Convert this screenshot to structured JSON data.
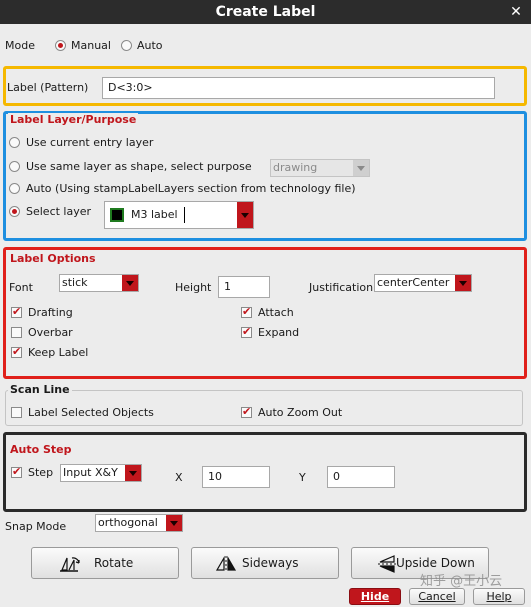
{
  "window": {
    "title": "Create Label",
    "close_glyph": "✕"
  },
  "mode": {
    "label": "Mode",
    "options": [
      {
        "label": "Manual",
        "selected": true
      },
      {
        "label": "Auto",
        "selected": false
      }
    ]
  },
  "label_pattern": {
    "label": "Label (Pattern)",
    "value": "D<3:0>"
  },
  "layer_purpose": {
    "title": "Label Layer/Purpose",
    "options": [
      {
        "label": "Use current entry layer",
        "selected": false
      },
      {
        "label": "Use same layer as shape, select purpose",
        "selected": false
      },
      {
        "label": "Auto (Using stampLabelLayers section from technology file)",
        "selected": false
      },
      {
        "label": "Select layer",
        "selected": true
      }
    ],
    "purpose_value": "drawing",
    "layer_value": "M3 label",
    "layer_swatch_color": "#1f7a1f"
  },
  "label_options": {
    "title": "Label Options",
    "font_label": "Font",
    "font_value": "stick",
    "height_label": "Height",
    "height_value": "1",
    "justification_label": "Justification",
    "justification_value": "centerCenter",
    "checks": [
      {
        "label": "Drafting",
        "checked": true
      },
      {
        "label": "Attach",
        "checked": true
      },
      {
        "label": "Overbar",
        "checked": false
      },
      {
        "label": "Expand",
        "checked": true
      },
      {
        "label": "Keep Label",
        "checked": true
      }
    ]
  },
  "scan_line": {
    "title": "Scan Line",
    "checks": [
      {
        "label": "Label Selected Objects",
        "checked": false
      },
      {
        "label": "Auto Zoom Out",
        "checked": true
      }
    ]
  },
  "auto_step": {
    "title": "Auto Step",
    "step_label": "Step",
    "step_checked": true,
    "step_mode": "Input X&Y",
    "x_label": "X",
    "x_value": "10",
    "y_label": "Y",
    "y_value": "0"
  },
  "snap_mode": {
    "label": "Snap Mode",
    "value": "orthogonal"
  },
  "buttons": {
    "rotate": "Rotate",
    "sideways": "Sideways",
    "upside_down": "Upside Down",
    "hide": "Hide",
    "cancel": "Cancel",
    "help": "Help"
  },
  "highlight_colors": {
    "label_pattern": "#f5b800",
    "layer_purpose": "#1e8fe0",
    "label_options": "#e0201a",
    "auto_step": "#2a2a2a"
  },
  "watermark": "知乎 @王小云"
}
